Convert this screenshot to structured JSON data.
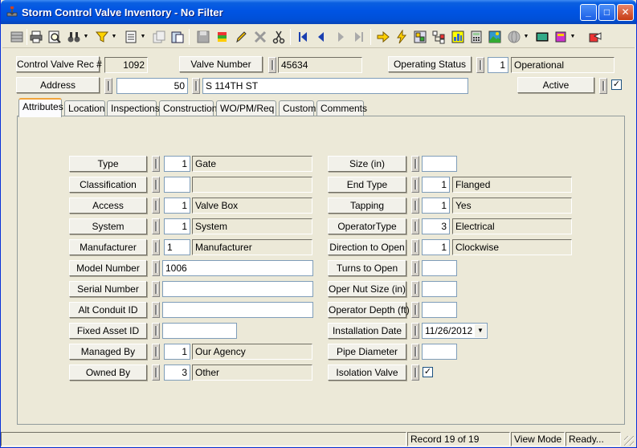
{
  "window": {
    "title": "Storm Control Valve Inventory - No Filter",
    "minimize": "_",
    "maximize": "□",
    "close": "✕"
  },
  "toolbar": {
    "icons": [
      "grid-icon",
      "print-icon",
      "print-preview-icon",
      "binoculars-icon",
      "filter-icon",
      "new-record-icon",
      "copy-record-icon",
      "paste-record-icon",
      "save-icon",
      "layers-icon",
      "pencil-icon",
      "delete-icon",
      "cut-icon",
      "first-record-icon",
      "previous-record-icon",
      "next-record-icon",
      "last-record-icon",
      "arrow-right-icon",
      "lightning-icon",
      "map-icon",
      "tree-icon",
      "chart-icon",
      "calculator-icon",
      "image-icon",
      "globe-icon",
      "terminal-icon",
      "book-icon",
      "exit-icon"
    ]
  },
  "header": {
    "rec_label": "Control Valve Rec #",
    "rec_value": "1092",
    "valve_number_label": "Valve Number",
    "valve_number_value": "45634",
    "operating_status_label": "Operating Status",
    "operating_status_code": "1",
    "operating_status_value": "Operational",
    "address_label": "Address",
    "address_number": "50",
    "address_street": "S 114TH ST",
    "active_label": "Active",
    "active_checked": "✓"
  },
  "tabs": [
    {
      "label": "Attributes",
      "active": true
    },
    {
      "label": "Location"
    },
    {
      "label": "Inspections"
    },
    {
      "label": "Construction"
    },
    {
      "label": "WO/PM/Req"
    },
    {
      "label": "Custom"
    },
    {
      "label": "Comments"
    }
  ],
  "attributes_left": [
    {
      "label": "Type",
      "code": "1",
      "value": "Gate"
    },
    {
      "label": "Classification",
      "code": "",
      "value": ""
    },
    {
      "label": "Access",
      "code": "1",
      "value": "Valve Box"
    },
    {
      "label": "System",
      "code": "1",
      "value": "System"
    },
    {
      "label": "Manufacturer",
      "code": "1",
      "value": "Manufacturer"
    },
    {
      "label": "Model Number",
      "value": "1006"
    },
    {
      "label": "Serial Number",
      "value": ""
    },
    {
      "label": "Alt Conduit ID",
      "value": ""
    },
    {
      "label": "Fixed Asset ID",
      "value": ""
    },
    {
      "label": "Managed By",
      "code": "1",
      "value": "Our Agency"
    },
    {
      "label": "Owned By",
      "code": "3",
      "value": "Other"
    }
  ],
  "attributes_right": [
    {
      "label": "Size (in)",
      "value": ""
    },
    {
      "label": "End Type",
      "code": "1",
      "value": "Flanged"
    },
    {
      "label": "Tapping",
      "code": "1",
      "value": "Yes"
    },
    {
      "label": "OperatorType",
      "code": "3",
      "value": "Electrical"
    },
    {
      "label": "Direction to Open",
      "code": "1",
      "value": "Clockwise"
    },
    {
      "label": "Turns to Open",
      "value": ""
    },
    {
      "label": "Oper Nut Size (in)",
      "value": ""
    },
    {
      "label": "Operator Depth (ft)",
      "value": ""
    },
    {
      "label": "Installation Date",
      "value": "11/26/2012"
    },
    {
      "label": "Pipe Diameter",
      "value": ""
    },
    {
      "label": "Isolation Valve",
      "checked": "✓"
    }
  ],
  "status": {
    "record": "Record 19 of 19",
    "mode": "View Mode",
    "ready": "Ready..."
  }
}
